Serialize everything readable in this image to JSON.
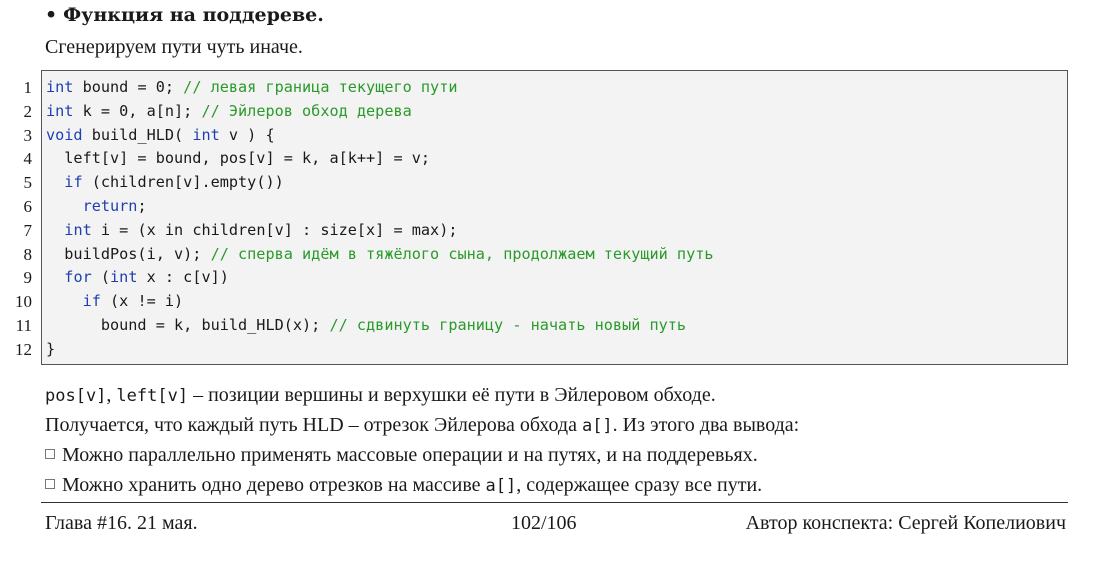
{
  "heading": {
    "bullet": "•",
    "text": "Функция на поддереве."
  },
  "intro": "Сгенерируем пути чуть иначе.",
  "code": {
    "line_numbers": [
      "1",
      "2",
      "3",
      "4",
      "5",
      "6",
      "7",
      "8",
      "9",
      "10",
      "11",
      "12"
    ],
    "lines": [
      [
        {
          "t": "int",
          "c": "kw"
        },
        {
          "t": " bound = 0; "
        },
        {
          "t": "// левая граница текущего пути",
          "c": "cm"
        }
      ],
      [
        {
          "t": "int",
          "c": "kw"
        },
        {
          "t": " k = 0, a[n]; "
        },
        {
          "t": "// Эйлеров обход дерева",
          "c": "cm"
        }
      ],
      [
        {
          "t": "void",
          "c": "kw"
        },
        {
          "t": " build_HLD( "
        },
        {
          "t": "int",
          "c": "kw"
        },
        {
          "t": " v ) {"
        }
      ],
      [
        {
          "t": "  left[v] = bound, pos[v] = k, a[k++] = v;"
        }
      ],
      [
        {
          "t": "  "
        },
        {
          "t": "if",
          "c": "kw"
        },
        {
          "t": " (children[v].empty())"
        }
      ],
      [
        {
          "t": "    "
        },
        {
          "t": "return",
          "c": "kw"
        },
        {
          "t": ";"
        }
      ],
      [
        {
          "t": "  "
        },
        {
          "t": "int",
          "c": "kw"
        },
        {
          "t": " i = (x in children[v] : size[x] = max);"
        }
      ],
      [
        {
          "t": "  buildPos(i, v); "
        },
        {
          "t": "// сперва идём в тяжёлого сына, продолжаем текущий путь",
          "c": "cm"
        }
      ],
      [
        {
          "t": "  "
        },
        {
          "t": "for",
          "c": "kw"
        },
        {
          "t": " ("
        },
        {
          "t": "int",
          "c": "kw"
        },
        {
          "t": " x : c[v])"
        }
      ],
      [
        {
          "t": "    "
        },
        {
          "t": "if",
          "c": "kw"
        },
        {
          "t": " (x != i)"
        }
      ],
      [
        {
          "t": "      bound = k, build_HLD(x); "
        },
        {
          "t": "// сдвинуть границу - начать новый путь",
          "c": "cm"
        }
      ],
      [
        {
          "t": "}"
        }
      ]
    ]
  },
  "para1": {
    "code1": "pos[v]",
    "sep": ", ",
    "code2": "left[v]",
    "rest": " – позиции вершины и верхушки её пути в Эйлеровом обходе."
  },
  "para2": {
    "before": "Получается, что каждый путь HLD – отрезок Эйлерова обхода ",
    "code": "a[]",
    "after": ". Из этого два вывода:"
  },
  "bullet1": "Можно параллельно применять массовые операции и на путях, и на поддеревьях.",
  "bullet2": {
    "before": "Можно хранить одно дерево отрезков на массиве ",
    "code": "a[]",
    "after": ", содержащее сразу все пути."
  },
  "footer": {
    "left": "Глава #16. 21 мая.",
    "center": "102/106",
    "right": "Автор конспекта: Сергей Копелиович"
  }
}
